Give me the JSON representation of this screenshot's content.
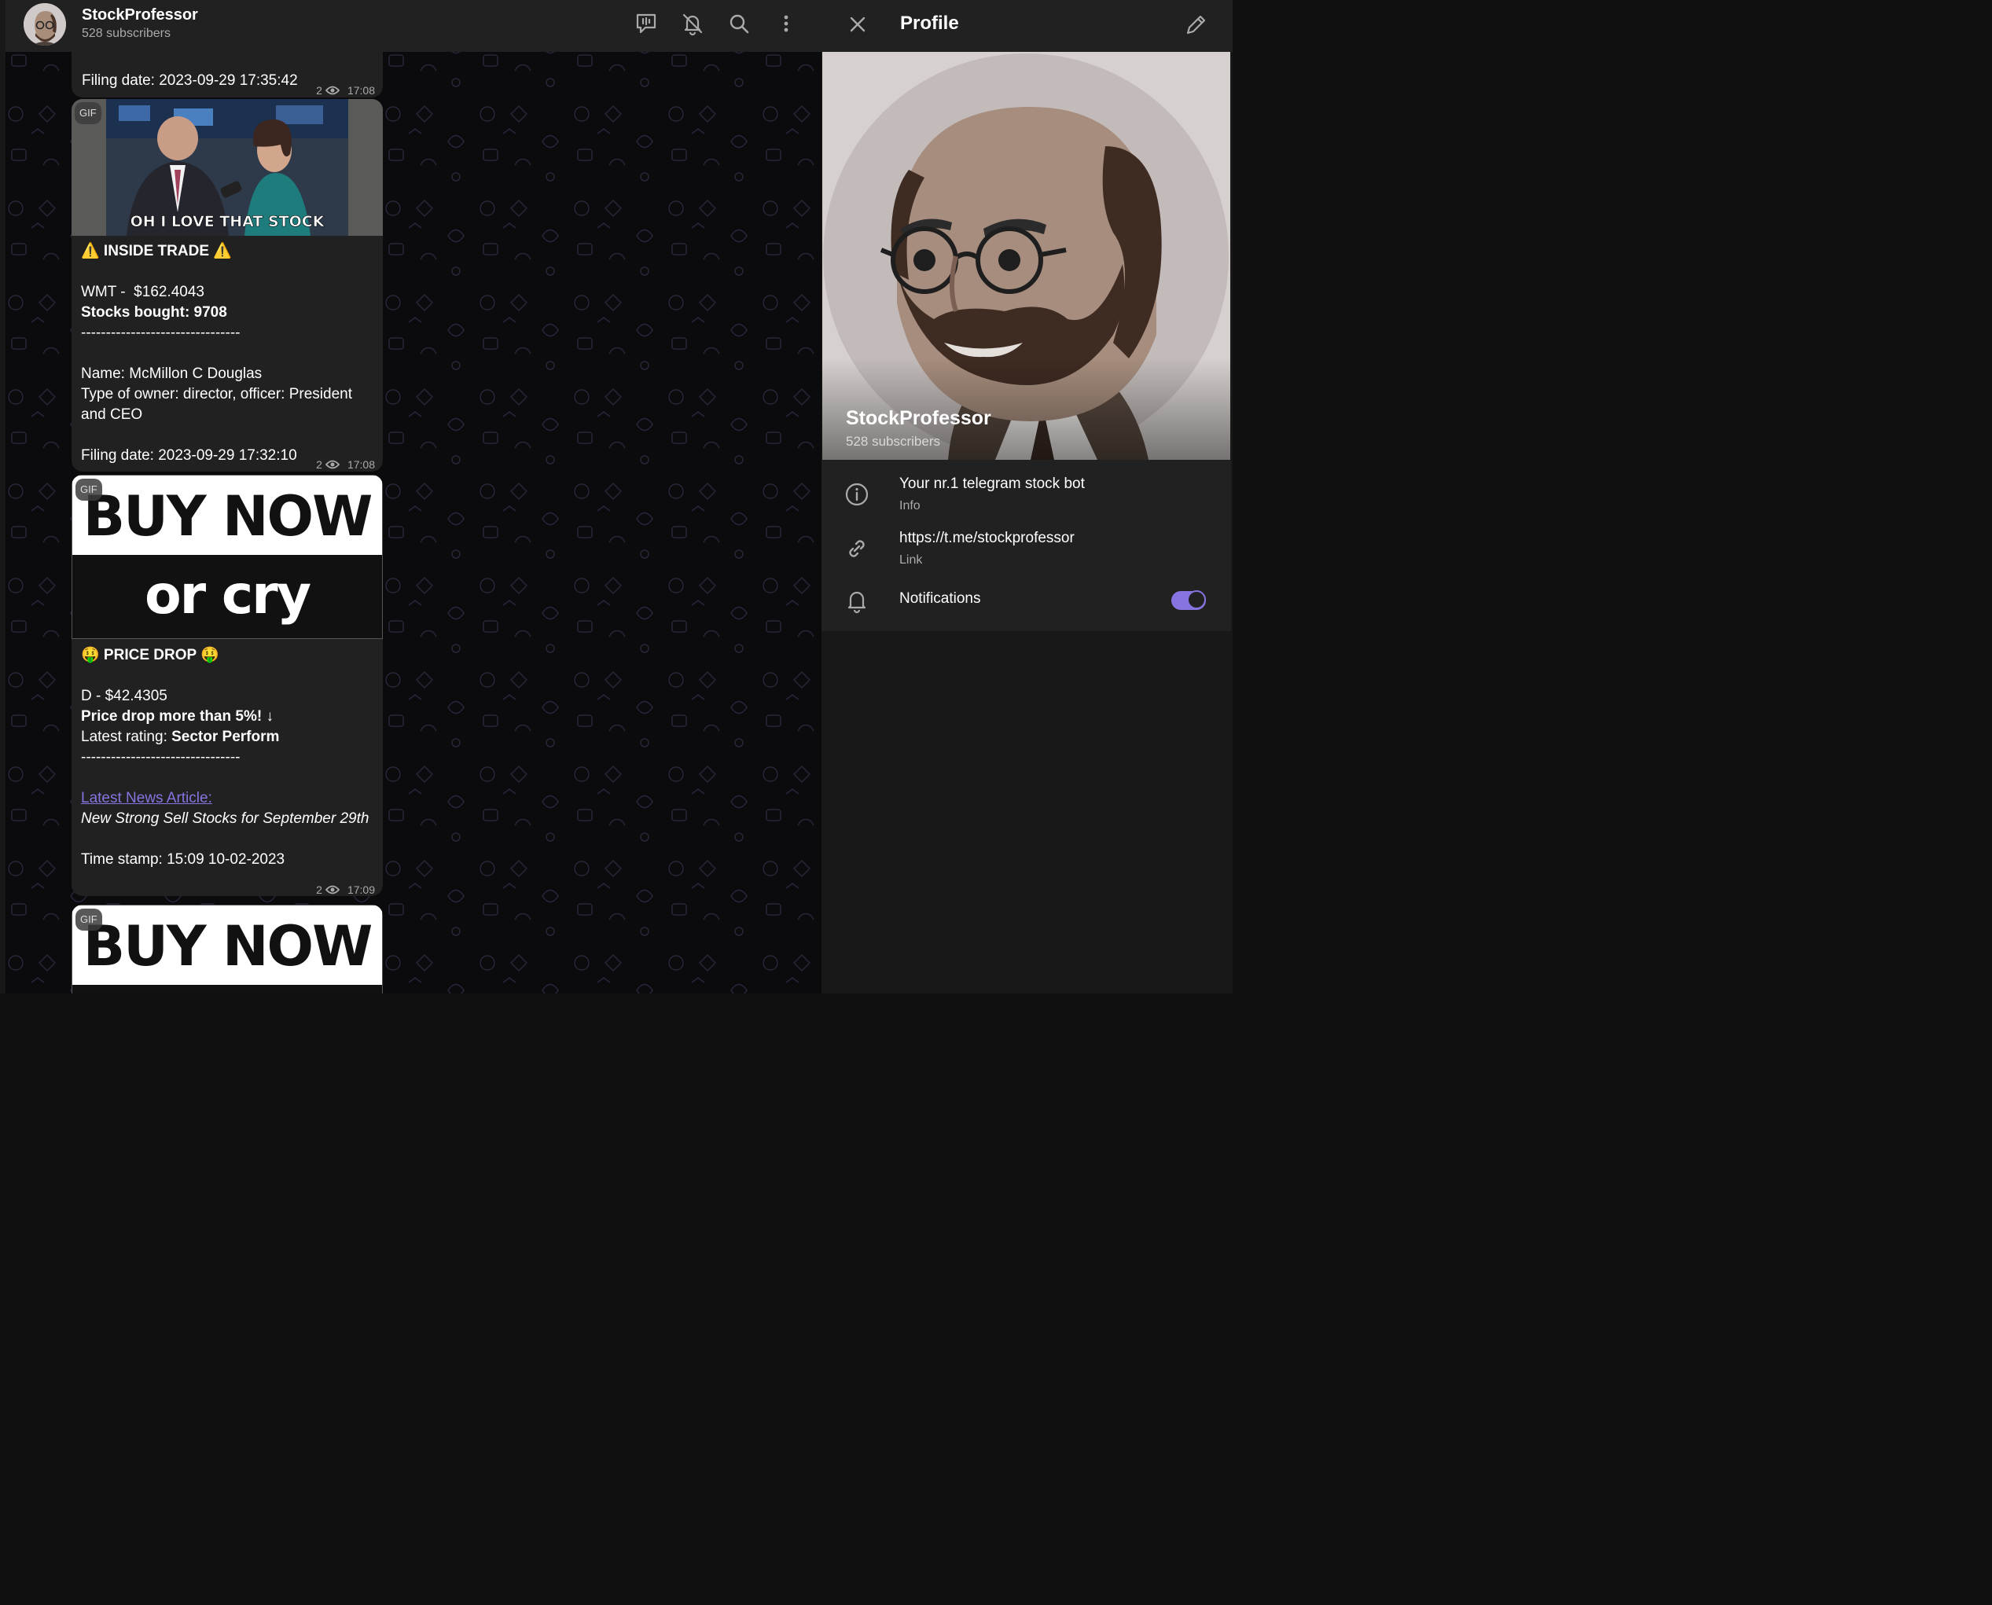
{
  "channel": {
    "name": "StockProfessor",
    "subscribers": "528 subscribers"
  },
  "header_icons": [
    "live-stream-icon",
    "bell-off-icon",
    "search-icon",
    "more-vertical-icon"
  ],
  "messages": [
    {
      "lines": [
        "Filing date: 2023-09-29 17:35:42"
      ],
      "views": "2",
      "time": "17:08"
    },
    {
      "gif_badge": "GIF",
      "gif_caption": "OH I LOVE THAT STOCK",
      "title": "⚠️ INSIDE TRADE ⚠️",
      "line1": "WMT -  $162.4043",
      "line2": "Stocks bought: 9708",
      "divider": "--------------------------------",
      "line3": "Name: McMillon C Douglas",
      "line4": "Type of owner: director, officer: President and CEO",
      "line5": "Filing date: 2023-09-29 17:32:10",
      "views": "2",
      "time": "17:08"
    },
    {
      "gif_badge": "GIF",
      "gif_top": "BUY NOW",
      "gif_bottom": "or cry later!",
      "title": "🤑 PRICE DROP 🤑",
      "line1": "D - $42.4305",
      "line2": "Price drop more than 5%! ↓",
      "line3_label": "Latest rating: ",
      "line3_value": "Sector Perform",
      "divider": "--------------------------------",
      "link": "Latest News Article:",
      "article": "New Strong Sell Stocks for September 29th",
      "timestamp": "Time stamp: 15:09 10-02-2023",
      "views": "2",
      "time": "17:09"
    },
    {
      "gif_badge": "GIF",
      "gif_top": "BUY NOW"
    }
  ],
  "profile": {
    "title": "Profile",
    "name": "StockProfessor",
    "subscribers": "528 subscribers",
    "description": "Your nr.1 telegram stock bot",
    "description_label": "Info",
    "link": "https://t.me/stockprofessor",
    "link_label": "Link",
    "notifications_label": "Notifications",
    "notifications_on": true
  },
  "colors": {
    "accent": "#8774e1",
    "panel": "#212121",
    "background": "#0b0b0d"
  }
}
